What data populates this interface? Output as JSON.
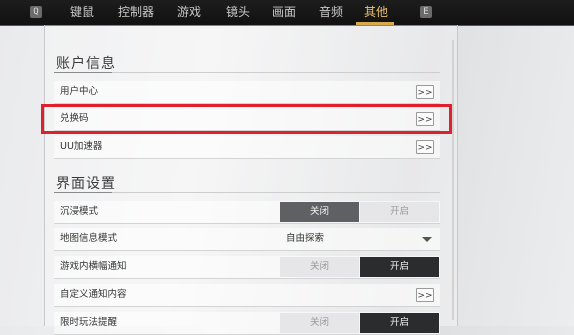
{
  "topbar": {
    "left_key": "Q",
    "right_key": "E",
    "tabs": [
      {
        "label": "键鼠"
      },
      {
        "label": "控制器"
      },
      {
        "label": "游戏"
      },
      {
        "label": "镜头"
      },
      {
        "label": "画面"
      },
      {
        "label": "音频"
      },
      {
        "label": "其他",
        "active": true
      }
    ]
  },
  "sections": {
    "account": {
      "title": "账户信息",
      "rows": [
        {
          "label": "用户中心",
          "button": ">>"
        },
        {
          "label": "兑换码",
          "button": ">>"
        },
        {
          "label": "UU加速器",
          "button": ">>"
        }
      ]
    },
    "interface": {
      "title": "界面设置",
      "rows": [
        {
          "label": "沉浸模式",
          "off_label": "关闭",
          "on_label": "开启",
          "selected": "关闭"
        },
        {
          "label": "地图信息模式",
          "select_value": "自由探索"
        },
        {
          "label": "游戏内横幅通知",
          "off_label": "关闭",
          "on_label": "开启",
          "selected": "开启"
        },
        {
          "label": "自定义通知内容",
          "button": ">>"
        },
        {
          "label": "限时玩法提醒",
          "off_label": "关闭",
          "on_label": "开启",
          "selected": "开启"
        }
      ]
    }
  },
  "colors": {
    "highlight": "#e0202d",
    "active_tab": "#e9c069"
  }
}
